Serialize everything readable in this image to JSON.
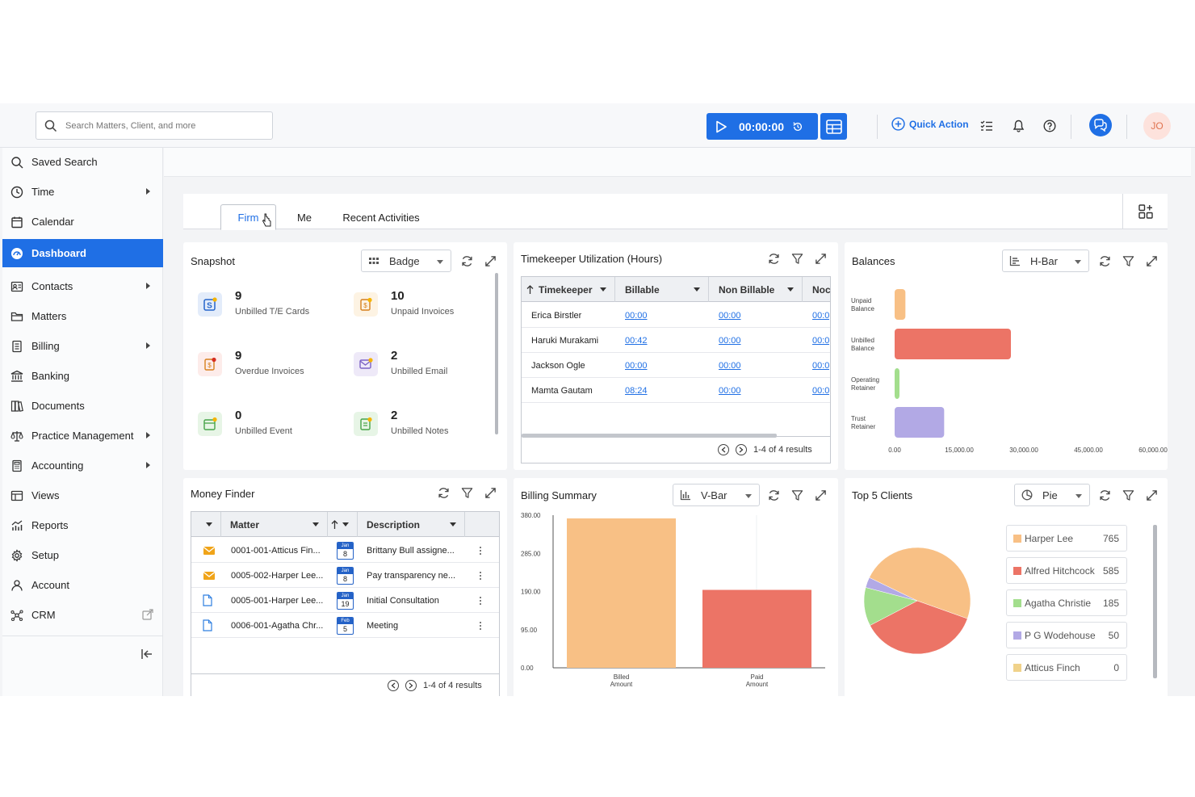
{
  "colors": {
    "accent": "#1f6fe5",
    "orange": "#f8c085",
    "red": "#ec7466",
    "green": "#a3de8d",
    "purple": "#b2a9e5",
    "tan": "#f0d28a"
  },
  "header": {
    "search_placeholder": "Search Matters, Client, and more",
    "timer": "00:00:00",
    "quick_action": "Quick Action",
    "avatar": "JO"
  },
  "sidebar": {
    "items": [
      {
        "label": "Saved Search",
        "icon": "search-icon",
        "arrow": false
      },
      {
        "label": "Time",
        "icon": "clock-icon",
        "arrow": true
      },
      {
        "label": "Calendar",
        "icon": "calendar-icon",
        "arrow": false
      },
      {
        "label": "Dashboard",
        "icon": "dashboard-icon",
        "arrow": false,
        "active": true
      },
      {
        "label": "Contacts",
        "icon": "contacts-icon",
        "arrow": true
      },
      {
        "label": "Matters",
        "icon": "folder-icon",
        "arrow": false
      },
      {
        "label": "Billing",
        "icon": "billing-icon",
        "arrow": true
      },
      {
        "label": "Banking",
        "icon": "bank-icon",
        "arrow": false
      },
      {
        "label": "Documents",
        "icon": "documents-icon",
        "arrow": false
      },
      {
        "label": "Practice Management",
        "icon": "scales-icon",
        "arrow": true
      },
      {
        "label": "Accounting",
        "icon": "calculator-icon",
        "arrow": true
      },
      {
        "label": "Views",
        "icon": "views-icon",
        "arrow": false
      },
      {
        "label": "Reports",
        "icon": "reports-icon",
        "arrow": false
      },
      {
        "label": "Setup",
        "icon": "gear-icon",
        "arrow": false
      },
      {
        "label": "Account",
        "icon": "user-icon",
        "arrow": false
      },
      {
        "label": "CRM",
        "icon": "crm-icon",
        "arrow": false
      }
    ]
  },
  "tabs": [
    {
      "label": "Firm",
      "active": true
    },
    {
      "label": "Me"
    },
    {
      "label": "Recent Activities"
    }
  ],
  "snapshot": {
    "title": "Snapshot",
    "view": "Badge",
    "items": [
      {
        "count": "9",
        "label": "Unbilled T/E Cards",
        "icon": "te-card-icon"
      },
      {
        "count": "10",
        "label": "Unpaid Invoices",
        "icon": "unpaid-invoice-icon"
      },
      {
        "count": "9",
        "label": "Overdue Invoices",
        "icon": "overdue-invoice-icon"
      },
      {
        "count": "2",
        "label": "Unbilled Email",
        "icon": "email-icon"
      },
      {
        "count": "0",
        "label": "Unbilled Event",
        "icon": "event-icon"
      },
      {
        "count": "2",
        "label": "Unbilled Notes",
        "icon": "notes-icon"
      }
    ]
  },
  "timekeeper": {
    "title": "Timekeeper Utilization (Hours)",
    "columns": [
      "Timekeeper",
      "Billable",
      "Non Billable",
      "Nocl"
    ],
    "rows": [
      {
        "name": "Erica Birstler",
        "billable": "00:00",
        "non_billable": "00:00",
        "nocharge": "00:0"
      },
      {
        "name": "Haruki Murakami",
        "billable": "00:42",
        "non_billable": "00:00",
        "nocharge": "00:0"
      },
      {
        "name": "Jackson Ogle",
        "billable": "00:00",
        "non_billable": "00:00",
        "nocharge": "00:0"
      },
      {
        "name": "Mamta Gautam",
        "billable": "08:24",
        "non_billable": "00:00",
        "nocharge": "00:0"
      }
    ],
    "pager": "1-4 of 4 results"
  },
  "balances": {
    "title": "Balances",
    "view": "H-Bar"
  },
  "money_finder": {
    "title": "Money Finder",
    "columns": [
      "Matter",
      "Description"
    ],
    "rows": [
      {
        "type": "email",
        "matter": "0001-001-Atticus Fin...",
        "month": "Jan",
        "day": "8",
        "description": "Brittany Bull assigne..."
      },
      {
        "type": "email",
        "matter": "0005-002-Harper Lee...",
        "month": "Jan",
        "day": "8",
        "description": "Pay transparency ne..."
      },
      {
        "type": "doc",
        "matter": "0005-001-Harper Lee...",
        "month": "Jan",
        "day": "19",
        "description": "Initial Consultation"
      },
      {
        "type": "doc",
        "matter": "0006-001-Agatha Chr...",
        "month": "Feb",
        "day": "5",
        "description": "Meeting"
      }
    ],
    "pager": "1-4 of 4 results"
  },
  "billing_summary": {
    "title": "Billing Summary",
    "view": "V-Bar"
  },
  "top_clients": {
    "title": "Top 5 Clients",
    "view": "Pie"
  },
  "chart_data": [
    {
      "type": "bar",
      "orientation": "horizontal",
      "title": "Balances",
      "categories": [
        "Unpaid Balance",
        "Unbilled Balance",
        "Operating Retainer",
        "Trust Retainer"
      ],
      "values": [
        2500,
        27000,
        1000,
        11500
      ],
      "colors": [
        "#f8c085",
        "#ec7466",
        "#a3de8d",
        "#b2a9e5"
      ],
      "xlim": [
        0,
        60000
      ],
      "xticks": [
        "0.00",
        "15,000.00",
        "30,000.00",
        "45,000.00",
        "60,000.00"
      ]
    },
    {
      "type": "bar",
      "title": "Billing Summary",
      "categories": [
        "Billed Amount",
        "Paid Amount"
      ],
      "values": [
        372,
        194
      ],
      "colors": [
        "#f8c085",
        "#ec7466"
      ],
      "ylim": [
        0,
        380
      ],
      "yticks": [
        "380.00",
        "285.00",
        "190.00",
        "95.00",
        "0.00"
      ]
    },
    {
      "type": "pie",
      "title": "Top 5 Clients",
      "labels": [
        "Harper Lee",
        "Alfred Hitchcock",
        "Agatha Christie",
        "P G Wodehouse",
        "Atticus Finch"
      ],
      "values": [
        765,
        585,
        185,
        50,
        0
      ],
      "colors": [
        "#f8c085",
        "#ec7466",
        "#a3de8d",
        "#b2a9e5",
        "#f0d28a"
      ]
    }
  ]
}
